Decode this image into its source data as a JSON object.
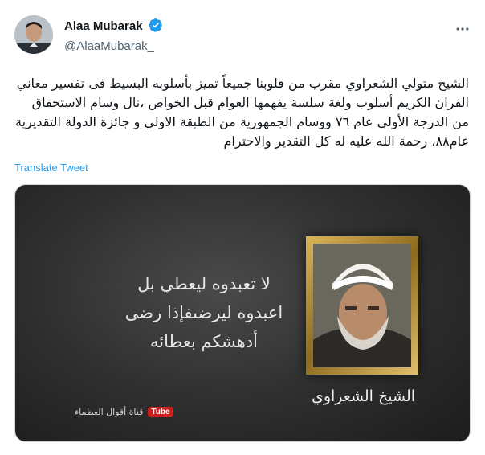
{
  "author": {
    "display_name": "Alaa Mubarak",
    "handle": "@AlaaMubarak_"
  },
  "tweet": {
    "text": "الشيخ متولي الشعراوي مقرب من قلوبنا جميعاً تميز بأسلوبه البسيط فى تفسير معاني القران الكريم أسلوب ولغة سلسة يفهمها العوام قبل الخواص ،نال وسام الاستحقاق من الدرجة الأولى عام ٧٦ ووسام الجمهورية من الطبقة الاولي و جائزة الدولة التقديرية عام٨٨، رحمة الله عليه له كل التقدير والاحترام",
    "translate_label": "Translate Tweet"
  },
  "media": {
    "quote_lines": [
      "لا تعبدوه ليعطي بل",
      "اعبدوه ليرضىفإذا رضى",
      "أدهشكم بعطائه"
    ],
    "caption": "الشيخ الشعراوي",
    "channel_name": "قناة أقوال العظماء",
    "channel_badge": "Tube"
  },
  "colors": {
    "link": "#1d9bf0",
    "verified": "#1d9bf0",
    "secondary_text": "#536471"
  },
  "icons": {
    "verified": "verified-badge-icon",
    "more": "more-options-icon"
  }
}
